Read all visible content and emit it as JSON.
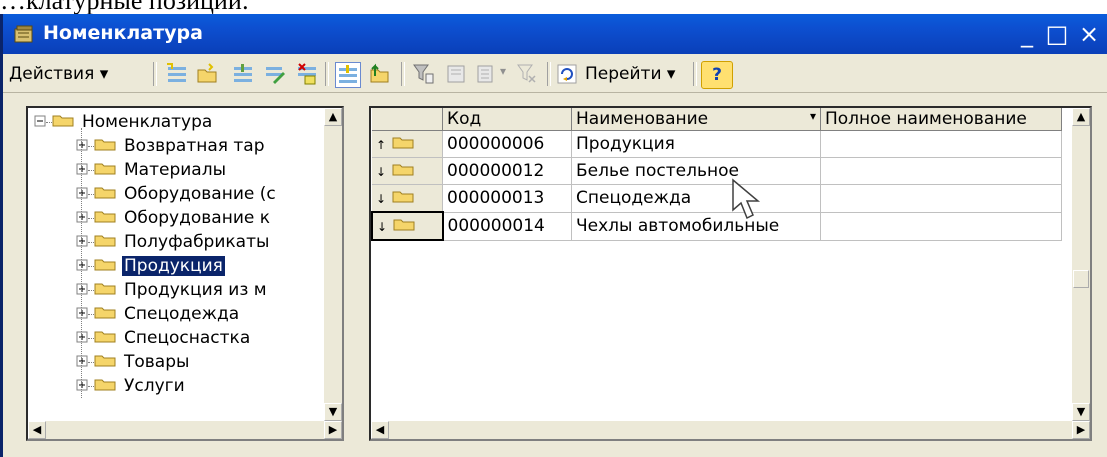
{
  "top_text": "…клатурные позиции:",
  "window": {
    "title": "Номенклатура",
    "controls": [
      "_",
      "□",
      "×"
    ]
  },
  "toolbar": {
    "actions_label": "Действия ▾",
    "goto_label": "Перейти ▾",
    "help_label": "?"
  },
  "tree": {
    "root": "Номенклатура",
    "items": [
      {
        "label": "Возвратная тар"
      },
      {
        "label": "Материалы"
      },
      {
        "label": "Оборудование (с"
      },
      {
        "label": "Оборудование к"
      },
      {
        "label": "Полуфабрикаты"
      },
      {
        "label": "Продукция",
        "selected": true
      },
      {
        "label": "Продукция из м"
      },
      {
        "label": "Спецодежда"
      },
      {
        "label": "Спецоснастка"
      },
      {
        "label": "Товары"
      },
      {
        "label": "Услуги"
      }
    ]
  },
  "grid": {
    "columns": [
      "Код",
      "Наименование",
      "Полное наименование"
    ],
    "sort_indicator": "▾",
    "rows": [
      {
        "code": "000000006",
        "name": "Продукция",
        "full_name": "",
        "marker": "up"
      },
      {
        "code": "000000012",
        "name": "Белье постельное",
        "full_name": "",
        "marker": "down"
      },
      {
        "code": "000000013",
        "name": "Спецодежда",
        "full_name": "",
        "marker": "down"
      },
      {
        "code": "000000014",
        "name": "Чехлы автомобильные",
        "full_name": "",
        "marker": "down",
        "active": true
      }
    ]
  },
  "colors": {
    "titlebar": "#0a4fd0",
    "selection": "#0a246a",
    "folder": "#f5d56a",
    "window_bg": "#ece9d8"
  }
}
